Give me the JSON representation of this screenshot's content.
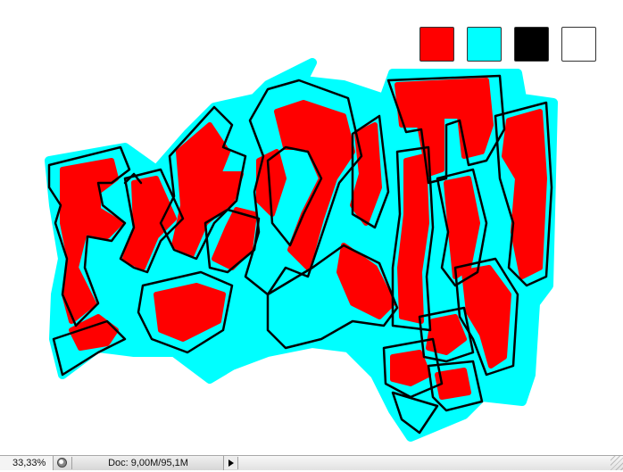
{
  "canvas": {
    "background": "#ffffff",
    "palette": [
      {
        "name": "red",
        "color": "#ff0000"
      },
      {
        "name": "cyan",
        "color": "#00ffff"
      },
      {
        "name": "black",
        "color": "#000000"
      },
      {
        "name": "white",
        "color": "#ffffff"
      }
    ],
    "artwork_colors": {
      "fill": "#ff0000",
      "outline": "#00ffff",
      "stroke": "#000000"
    }
  },
  "statusbar": {
    "zoom": "33,33%",
    "proof_icon": "soft-proof-icon",
    "doc_info": "Doc: 9,00M/95,1M",
    "menu_icon": "triangle-right-icon"
  }
}
